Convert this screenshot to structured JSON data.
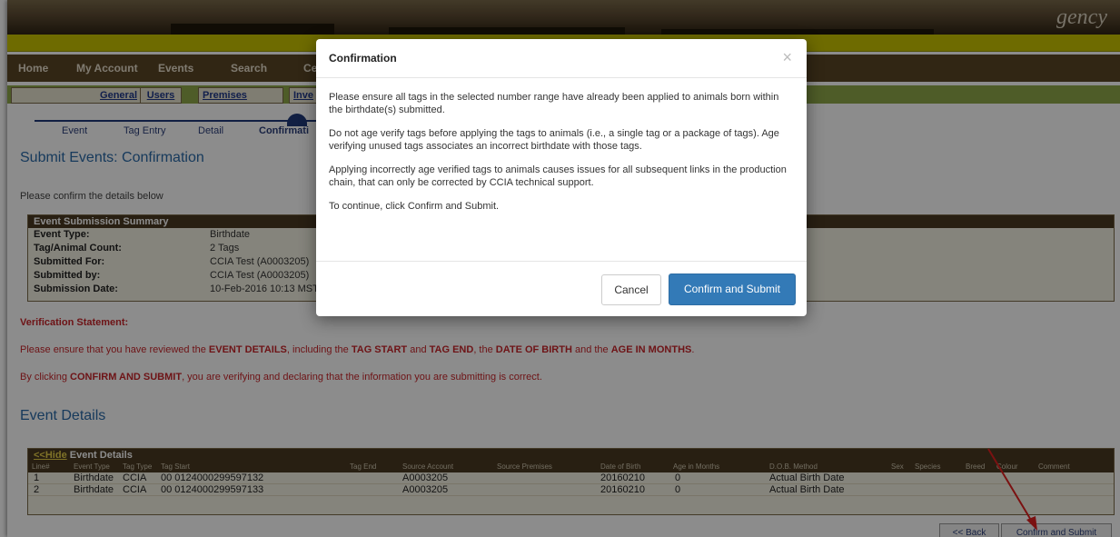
{
  "header": {
    "brand_fragment": "gency"
  },
  "nav": {
    "items": [
      {
        "label": "Home"
      },
      {
        "label": "My Account"
      },
      {
        "label": "Events"
      },
      {
        "label": "Search"
      },
      {
        "label": "Ce"
      }
    ]
  },
  "subtabs": [
    {
      "label": "General"
    },
    {
      "label": "Users"
    },
    {
      "label": "Premises"
    },
    {
      "label": "Inve"
    }
  ],
  "steps": [
    "Event",
    "Tag Entry",
    "Detail",
    "Confirmati"
  ],
  "page": {
    "title": "Submit Events: Confirmation",
    "confirm_text": "Please confirm the details below"
  },
  "summary": {
    "header": "Event Submission Summary",
    "rows": [
      {
        "label": "Event Type:",
        "value": "Birthdate"
      },
      {
        "label": "Tag/Animal Count:",
        "value": "2 Tags"
      },
      {
        "label": "Submitted For:",
        "value": "CCIA Test (A0003205)"
      },
      {
        "label": "Submitted by:",
        "value": "CCIA Test (A0003205)"
      },
      {
        "label": "Submission Date:",
        "value": "10-Feb-2016 10:13 MST"
      }
    ]
  },
  "verification": {
    "title": "Verification Statement:",
    "line1_a": "Please ensure that you have reviewed the ",
    "line1_b": "EVENT DETAILS",
    "line1_c": ", including the ",
    "line1_d": "TAG START",
    "line1_e": " and ",
    "line1_f": "TAG END",
    "line1_g": ", the ",
    "line1_h": "DATE OF BIRTH",
    "line1_i": " and the ",
    "line1_j": "AGE IN MONTHS",
    "line1_k": ".",
    "line2_a": "By clicking ",
    "line2_b": "CONFIRM AND SUBMIT",
    "line2_c": ", you are verifying and declaring that the information you are submitting is correct."
  },
  "events": {
    "title": "Event Details",
    "hide_link": "<<Hide",
    "bar_label": " Event Details",
    "columns": [
      "Line#",
      "Event Type",
      "Tag Type",
      "Tag Start",
      "Tag End",
      "Source Account",
      "Source Premises",
      "Date of Birth",
      "Age in Months",
      "D.O.B. Method",
      "Sex",
      "Species",
      "Breed",
      "Colour",
      "Comment"
    ],
    "rows": [
      {
        "line": "1",
        "event_type": "Birthdate",
        "tag_type": "CCIA",
        "tag_start": "00 0124000299597132",
        "source_account": "A0003205",
        "dob": "20160210",
        "age": "0",
        "method": "Actual Birth Date"
      },
      {
        "line": "2",
        "event_type": "Birthdate",
        "tag_type": "CCIA",
        "tag_start": "00 0124000299597133",
        "source_account": "A0003205",
        "dob": "20160210",
        "age": "0",
        "method": "Actual Birth Date"
      }
    ]
  },
  "page_buttons": {
    "back": "<< Back",
    "confirm": "Confirm and Submit"
  },
  "modal": {
    "title": "Confirmation",
    "close": "×",
    "paragraphs": [
      "Please ensure all tags in the selected number range have already been applied to animals born within the birthdate(s) submitted.",
      "Do not age verify tags before applying the tags to animals (i.e., a single tag or a package of tags). Age verifying unused tags associates an incorrect birthdate with those tags.",
      "Applying incorrectly age verified tags to animals causes issues for all subsequent links in the production chain, that can only be corrected by CCIA technical support.",
      "To continue, click Confirm and Submit."
    ],
    "cancel_label": "Cancel",
    "submit_label": "Confirm and Submit"
  },
  "colors": {
    "accent": "#337ab7",
    "warning": "#c8262b",
    "nav_bg": "#5a4526",
    "arrow": "#e02020"
  }
}
